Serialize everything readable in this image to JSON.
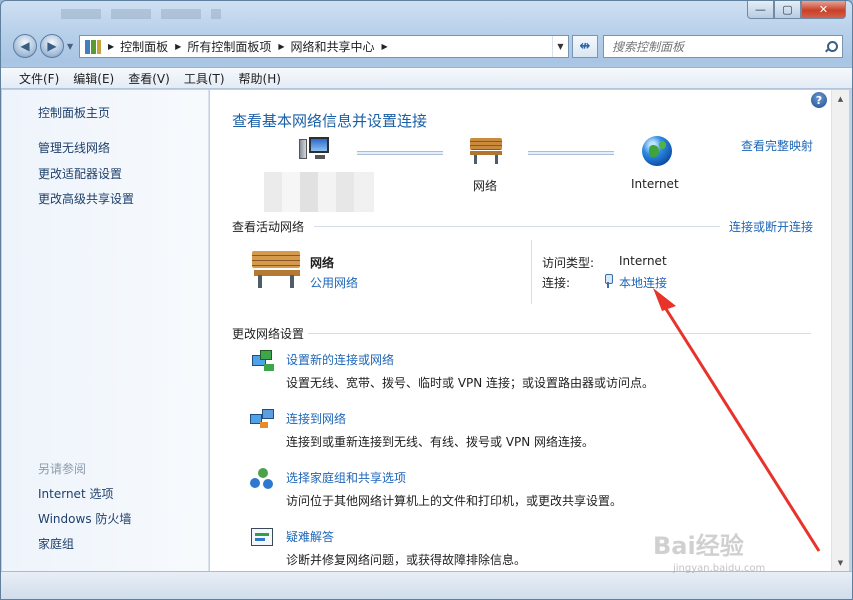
{
  "breadcrumb": [
    "控制面板",
    "所有控制面板项",
    "网络和共享中心"
  ],
  "search": {
    "placeholder": "搜索控制面板"
  },
  "menu": [
    "文件(F)",
    "编辑(E)",
    "查看(V)",
    "工具(T)",
    "帮助(H)"
  ],
  "sidebar": {
    "home": "控制面板主页",
    "links": [
      "管理无线网络",
      "更改适配器设置",
      "更改高级共享设置"
    ],
    "see_also_heading": "另请参阅",
    "see_also": [
      "Internet 选项",
      "Windows 防火墙",
      "家庭组"
    ]
  },
  "main": {
    "title": "查看基本网络信息并设置连接",
    "map_link": "查看完整映射",
    "map": {
      "network": "网络",
      "internet": "Internet"
    },
    "active": {
      "heading": "查看活动网络",
      "link": "连接或断开连接",
      "name": "网络",
      "type": "公用网络",
      "access_label": "访问类型:",
      "access_value": "Internet",
      "conn_label": "连接:",
      "conn_value": "本地连接"
    },
    "change": {
      "heading": "更改网络设置",
      "tasks": [
        {
          "icon": "new-connection-icon",
          "link": "设置新的连接或网络",
          "desc": "设置无线、宽带、拨号、临时或 VPN 连接；或设置路由器或访问点。"
        },
        {
          "icon": "connect-to-network-icon",
          "link": "连接到网络",
          "desc": "连接到或重新连接到无线、有线、拨号或 VPN 网络连接。"
        },
        {
          "icon": "homegroup-icon",
          "link": "选择家庭组和共享选项",
          "desc": "访问位于其他网络计算机上的文件和打印机，或更改共享设置。"
        },
        {
          "icon": "troubleshoot-icon",
          "link": "疑难解答",
          "desc": "诊断并修复网络问题，或获得故障排除信息。"
        }
      ]
    }
  },
  "watermark": {
    "brand": "Bai经验",
    "url": "jingyan.baidu.com"
  },
  "colors": {
    "link": "#1e66b8",
    "title": "#1b5fa6",
    "arrow": "#e8322a"
  }
}
